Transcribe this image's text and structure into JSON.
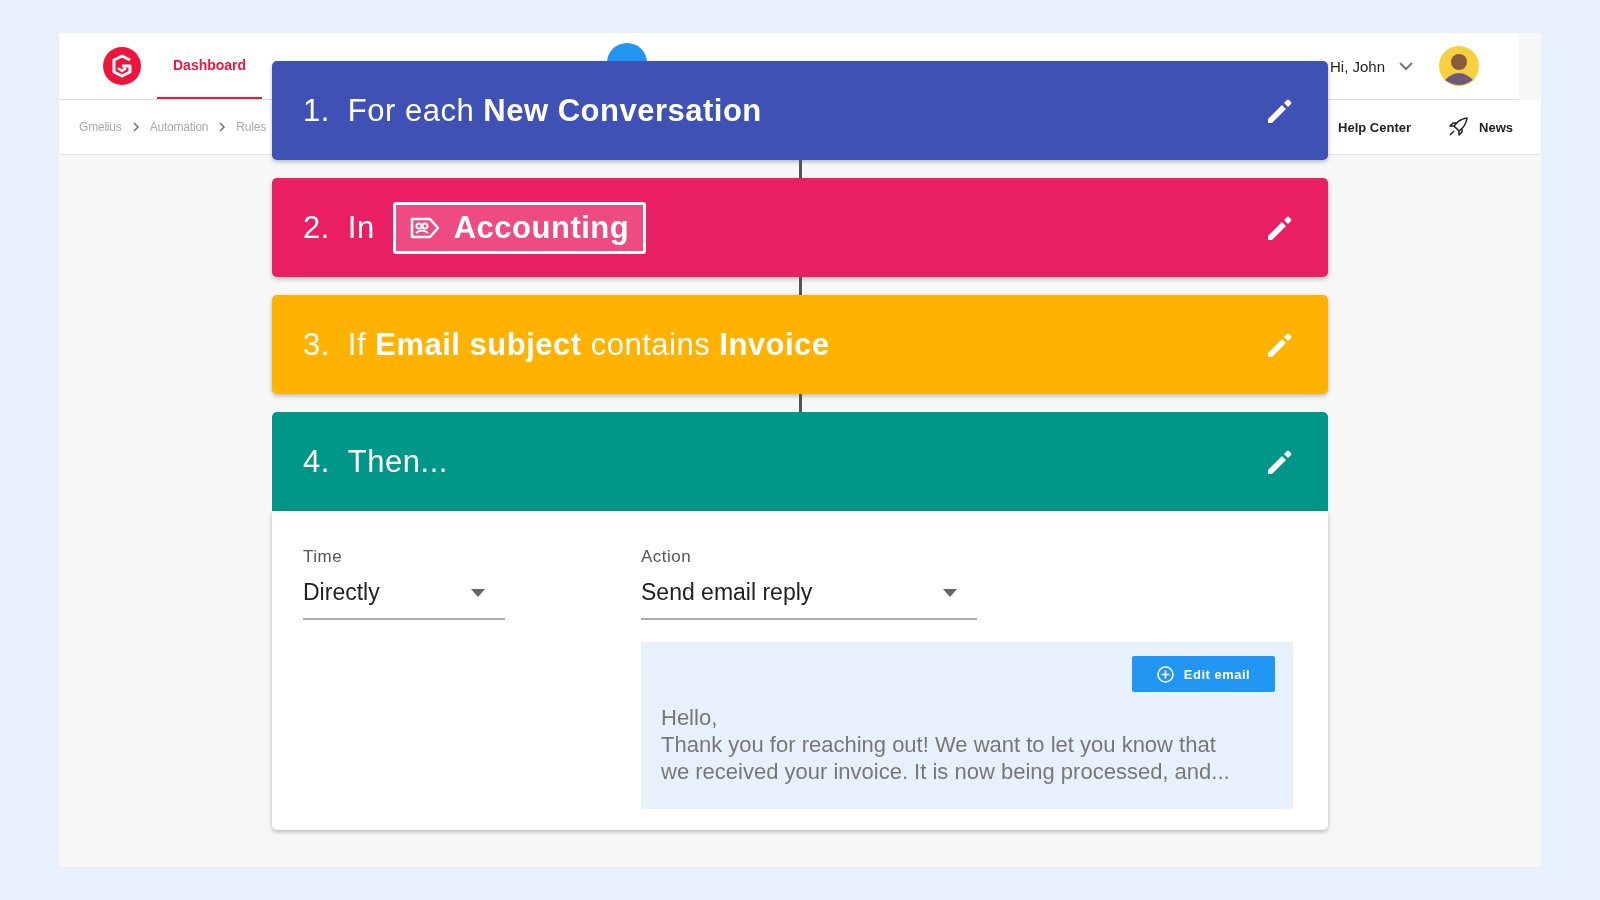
{
  "app_header": {
    "nav_tabs": [
      {
        "label": "Dashboard",
        "selected": true
      }
    ],
    "greeting": "Hi, John"
  },
  "breadcrumbs": [
    "Gmelius",
    "Automation",
    "Rules"
  ],
  "header_links": [
    {
      "kind": "help",
      "label": "Help Center"
    },
    {
      "kind": "news",
      "label": "News"
    }
  ],
  "steps": [
    {
      "number": "1.",
      "kind": "text",
      "text": "For each **New Conversation**",
      "color": "#3f51b5"
    },
    {
      "number": "2.",
      "kind": "label",
      "text": "In",
      "label": "Accounting",
      "color": "#e91e63"
    },
    {
      "number": "3.",
      "kind": "text",
      "text": "If **Email subject** contains **Invoice**",
      "color": "#ffb300"
    },
    {
      "number": "4.",
      "kind": "text",
      "text": "Then...",
      "color": "#009688"
    }
  ],
  "action_panel": {
    "time": {
      "label": "Time",
      "value": "Directly"
    },
    "action": {
      "label": "Action",
      "value": "Send email reply"
    },
    "email_preview": {
      "button": "Edit email",
      "lines": [
        "Hello,",
        "Thank you for reaching out! We want to let you know that we received your invoice. It is now being processed, and..."
      ]
    }
  }
}
